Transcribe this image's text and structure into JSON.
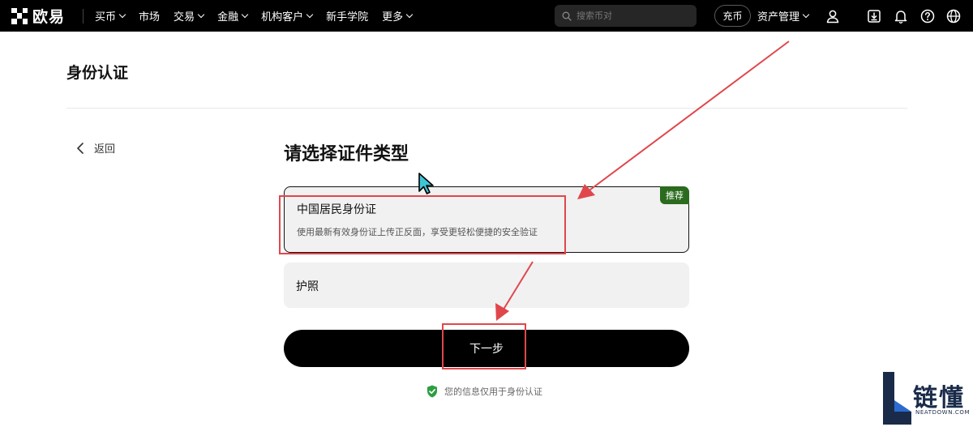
{
  "header": {
    "logo_text": "欧易",
    "nav": [
      {
        "label": "买币",
        "dropdown": true
      },
      {
        "label": "市场",
        "dropdown": false
      },
      {
        "label": "交易",
        "dropdown": true
      },
      {
        "label": "金融",
        "dropdown": true
      },
      {
        "label": "机构客户",
        "dropdown": true
      },
      {
        "label": "新手学院",
        "dropdown": false
      },
      {
        "label": "更多",
        "dropdown": true
      }
    ],
    "search_placeholder": "搜索币对",
    "deposit_label": "充币",
    "asset_label": "资产管理",
    "icons": [
      "user-icon",
      "download-icon",
      "bell-icon",
      "help-icon",
      "globe-icon"
    ]
  },
  "page": {
    "title": "身份认证",
    "back_label": "返回",
    "section_title": "请选择证件类型",
    "options": [
      {
        "title": "中国居民身份证",
        "description": "使用最新有效身份证上传正反面，享受更轻松便捷的安全验证",
        "badge": "推荐",
        "selected": true
      },
      {
        "title": "护照",
        "description": "",
        "badge": "",
        "selected": false
      }
    ],
    "next_label": "下一步",
    "privacy_note": "您的信息仅用于身份认证"
  },
  "watermark": {
    "text": "链懂",
    "subtext": "NEATDOWN.COM"
  },
  "colors": {
    "topbar": "#000000",
    "badge": "#2a6b1e",
    "annotation": "#e0474c",
    "shield": "#2e9e43",
    "option_bg": "#f1f1f1"
  }
}
